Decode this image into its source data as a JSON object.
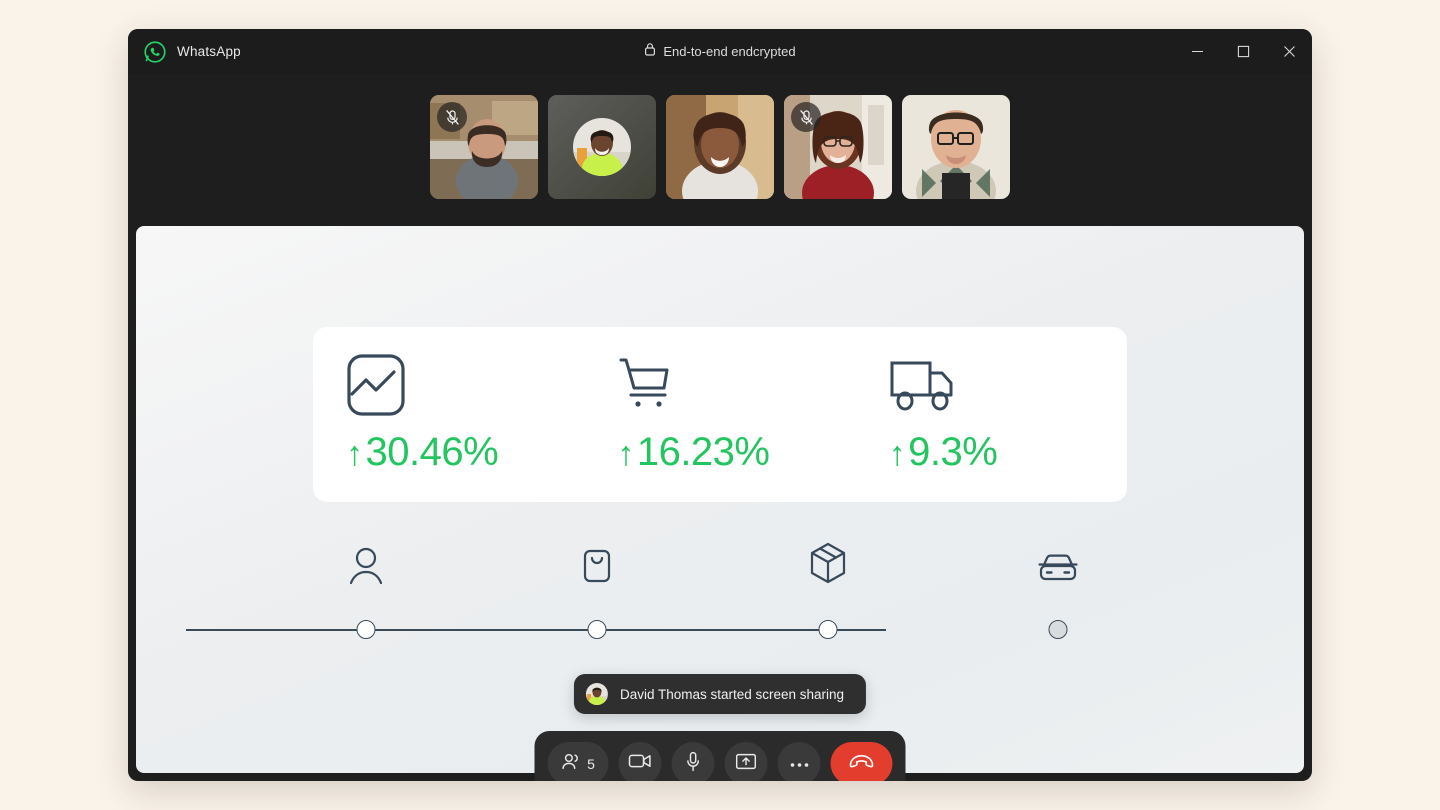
{
  "page": {
    "background_color": "#faf3ea"
  },
  "window": {
    "app_name": "WhatsApp",
    "logo_icon": "whatsapp-logo-icon",
    "encryption_label": "End-to-end endcrypted",
    "lock_icon": "lock-icon",
    "controls": [
      {
        "name": "minimize",
        "icon": "minimize-icon",
        "glyph": "minimize"
      },
      {
        "name": "maximize",
        "icon": "maximize-icon",
        "glyph": "maximize"
      },
      {
        "name": "close",
        "icon": "close-icon",
        "glyph": "close"
      }
    ]
  },
  "participants": {
    "tiles": [
      {
        "id": "tile-1",
        "muted": true,
        "mute_icon": "mic-muted-icon",
        "camera_on": true,
        "scene": "man-beard-kitchen"
      },
      {
        "id": "tile-2",
        "muted": false,
        "mute_icon": "",
        "camera_on": false,
        "scene": "avatar-placeholder",
        "avatar": "man-green-shirt"
      },
      {
        "id": "tile-3",
        "muted": false,
        "mute_icon": "",
        "camera_on": true,
        "scene": "woman-white-turtleneck"
      },
      {
        "id": "tile-4",
        "muted": true,
        "mute_icon": "mic-muted-icon",
        "camera_on": true,
        "scene": "woman-glasses-red-sweater"
      },
      {
        "id": "tile-5",
        "muted": false,
        "mute_icon": "",
        "camera_on": true,
        "scene": "man-glasses-argyle-sweater"
      }
    ]
  },
  "shared_screen": {
    "metrics_card": {
      "accent_color": "#22c55e",
      "icon_color": "#37495a",
      "items": [
        {
          "icon": "line-chart-icon",
          "arrow": "↑",
          "value": "30.46%",
          "direction": "up"
        },
        {
          "icon": "shopping-cart-icon",
          "arrow": "↑",
          "value": "16.23%",
          "direction": "up"
        },
        {
          "icon": "delivery-truck-icon",
          "arrow": "↑",
          "value": "9.3%",
          "direction": "up"
        }
      ]
    },
    "stepper": {
      "line_color": "#3a4a57",
      "steps": [
        {
          "icon": "person-icon",
          "state": "open"
        },
        {
          "icon": "shopping-bag-icon",
          "state": "open"
        },
        {
          "icon": "package-box-icon",
          "state": "open"
        },
        {
          "icon": "car-front-icon",
          "state": "filled"
        }
      ]
    }
  },
  "toast": {
    "avatar_icon": "participant-avatar",
    "message": "David Thomas started screen sharing"
  },
  "controls": {
    "participants": {
      "icon": "people-icon",
      "count": "5"
    },
    "camera": {
      "icon": "video-camera-icon"
    },
    "microphone": {
      "icon": "microphone-icon"
    },
    "share_screen": {
      "icon": "share-screen-icon"
    },
    "more": {
      "icon": "more-options-icon"
    },
    "end_call": {
      "icon": "hang-up-icon",
      "color": "#e33d2e"
    }
  }
}
